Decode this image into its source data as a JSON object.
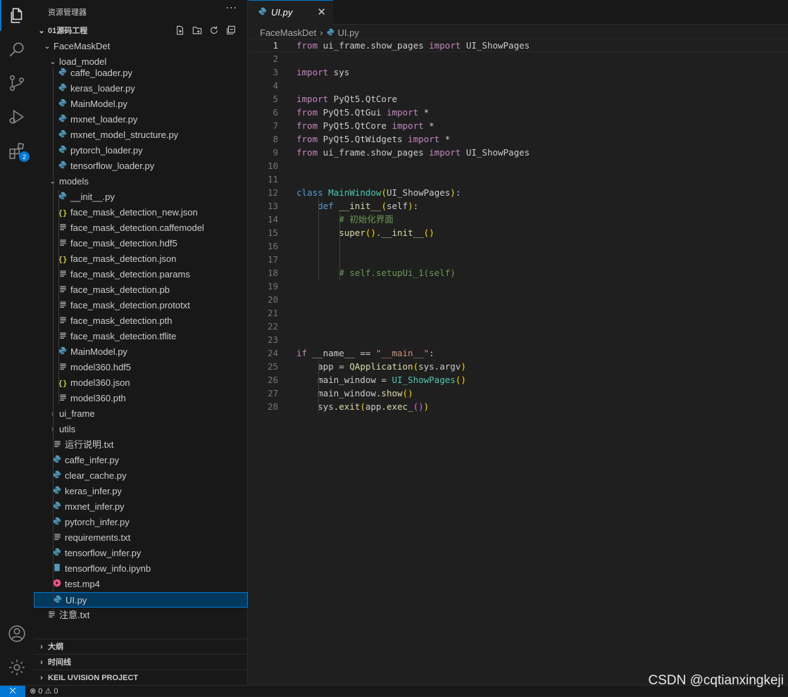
{
  "sidebar": {
    "title": "资源管理器",
    "more": "···",
    "root_label": "01源码工程",
    "panels": [
      "大纲",
      "时间线",
      "KEIL UVISION PROJECT"
    ],
    "rows": [
      {
        "label": "FaceMaskDet",
        "type": "folder-open"
      },
      {
        "label": "load_model",
        "type": "folder-open"
      },
      {
        "label": "caffe_loader.py",
        "type": "py"
      },
      {
        "label": "keras_loader.py",
        "type": "py"
      },
      {
        "label": "MainModel.py",
        "type": "py"
      },
      {
        "label": "mxnet_loader.py",
        "type": "py"
      },
      {
        "label": "mxnet_model_structure.py",
        "type": "py"
      },
      {
        "label": "pytorch_loader.py",
        "type": "py"
      },
      {
        "label": "tensorflow_loader.py",
        "type": "py"
      },
      {
        "label": "models",
        "type": "folder-open"
      },
      {
        "label": "__init__.py",
        "type": "py"
      },
      {
        "label": "face_mask_detection_new.json",
        "type": "json"
      },
      {
        "label": "face_mask_detection.caffemodel",
        "type": "txt"
      },
      {
        "label": "face_mask_detection.hdf5",
        "type": "txt"
      },
      {
        "label": "face_mask_detection.json",
        "type": "json"
      },
      {
        "label": "face_mask_detection.params",
        "type": "txt"
      },
      {
        "label": "face_mask_detection.pb",
        "type": "txt"
      },
      {
        "label": "face_mask_detection.prototxt",
        "type": "txt"
      },
      {
        "label": "face_mask_detection.pth",
        "type": "txt"
      },
      {
        "label": "face_mask_detection.tflite",
        "type": "txt"
      },
      {
        "label": "MainModel.py",
        "type": "py"
      },
      {
        "label": "model360.hdf5",
        "type": "txt"
      },
      {
        "label": "model360.json",
        "type": "json"
      },
      {
        "label": "model360.pth",
        "type": "txt"
      },
      {
        "label": "ui_frame",
        "type": "folder-closed"
      },
      {
        "label": "utils",
        "type": "folder-closed"
      },
      {
        "label": "运行说明.txt",
        "type": "txt"
      },
      {
        "label": "caffe_infer.py",
        "type": "py"
      },
      {
        "label": "clear_cache.py",
        "type": "py"
      },
      {
        "label": "keras_infer.py",
        "type": "py"
      },
      {
        "label": "mxnet_infer.py",
        "type": "py"
      },
      {
        "label": "pytorch_infer.py",
        "type": "py"
      },
      {
        "label": "requirements.txt",
        "type": "txt"
      },
      {
        "label": "tensorflow_infer.py",
        "type": "py"
      },
      {
        "label": "tensorflow_info.ipynb",
        "type": "ipynb"
      },
      {
        "label": "test.mp4",
        "type": "mp4"
      },
      {
        "label": "UI.py",
        "type": "py"
      },
      {
        "label": "注意.txt",
        "type": "txt"
      }
    ]
  },
  "activity": {
    "items": [
      "explorer-icon",
      "search-icon",
      "source-control-icon",
      "run-debug-icon",
      "extensions-icon"
    ],
    "extensions_badge": "2",
    "bottom": [
      "account-icon",
      "settings-gear-icon"
    ]
  },
  "tab": {
    "label": "UI.py",
    "close": "✕"
  },
  "breadcrumb": {
    "folder": "FaceMaskDet",
    "sep": "›",
    "file": "UI.py"
  },
  "editor": {
    "lines": [
      "from ui_frame.show_pages import UI_ShowPages",
      "",
      "import sys",
      "",
      "import PyQt5.QtCore",
      "from PyQt5.QtGui import *",
      "from PyQt5.QtCore import *",
      "from PyQt5.QtWidgets import *",
      "from ui_frame.show_pages import UI_ShowPages",
      "",
      "",
      "class MainWindow(UI_ShowPages):",
      "    def __init__(self):",
      "        # 初始化界面",
      "        super().__init__()",
      "",
      "",
      "        # self.setupUi_1(self)",
      "",
      "",
      "",
      "",
      "",
      "if __name__ == \"__main__\":",
      "    app = QApplication(sys.argv)",
      "    main_window = UI_ShowPages()",
      "    main_window.show()",
      "    sys.exit(app.exec_())"
    ]
  },
  "status": {
    "remote": "⨉",
    "errors": "0",
    "warnings": "0"
  },
  "watermark": "CSDN @cqtianxingkeji"
}
